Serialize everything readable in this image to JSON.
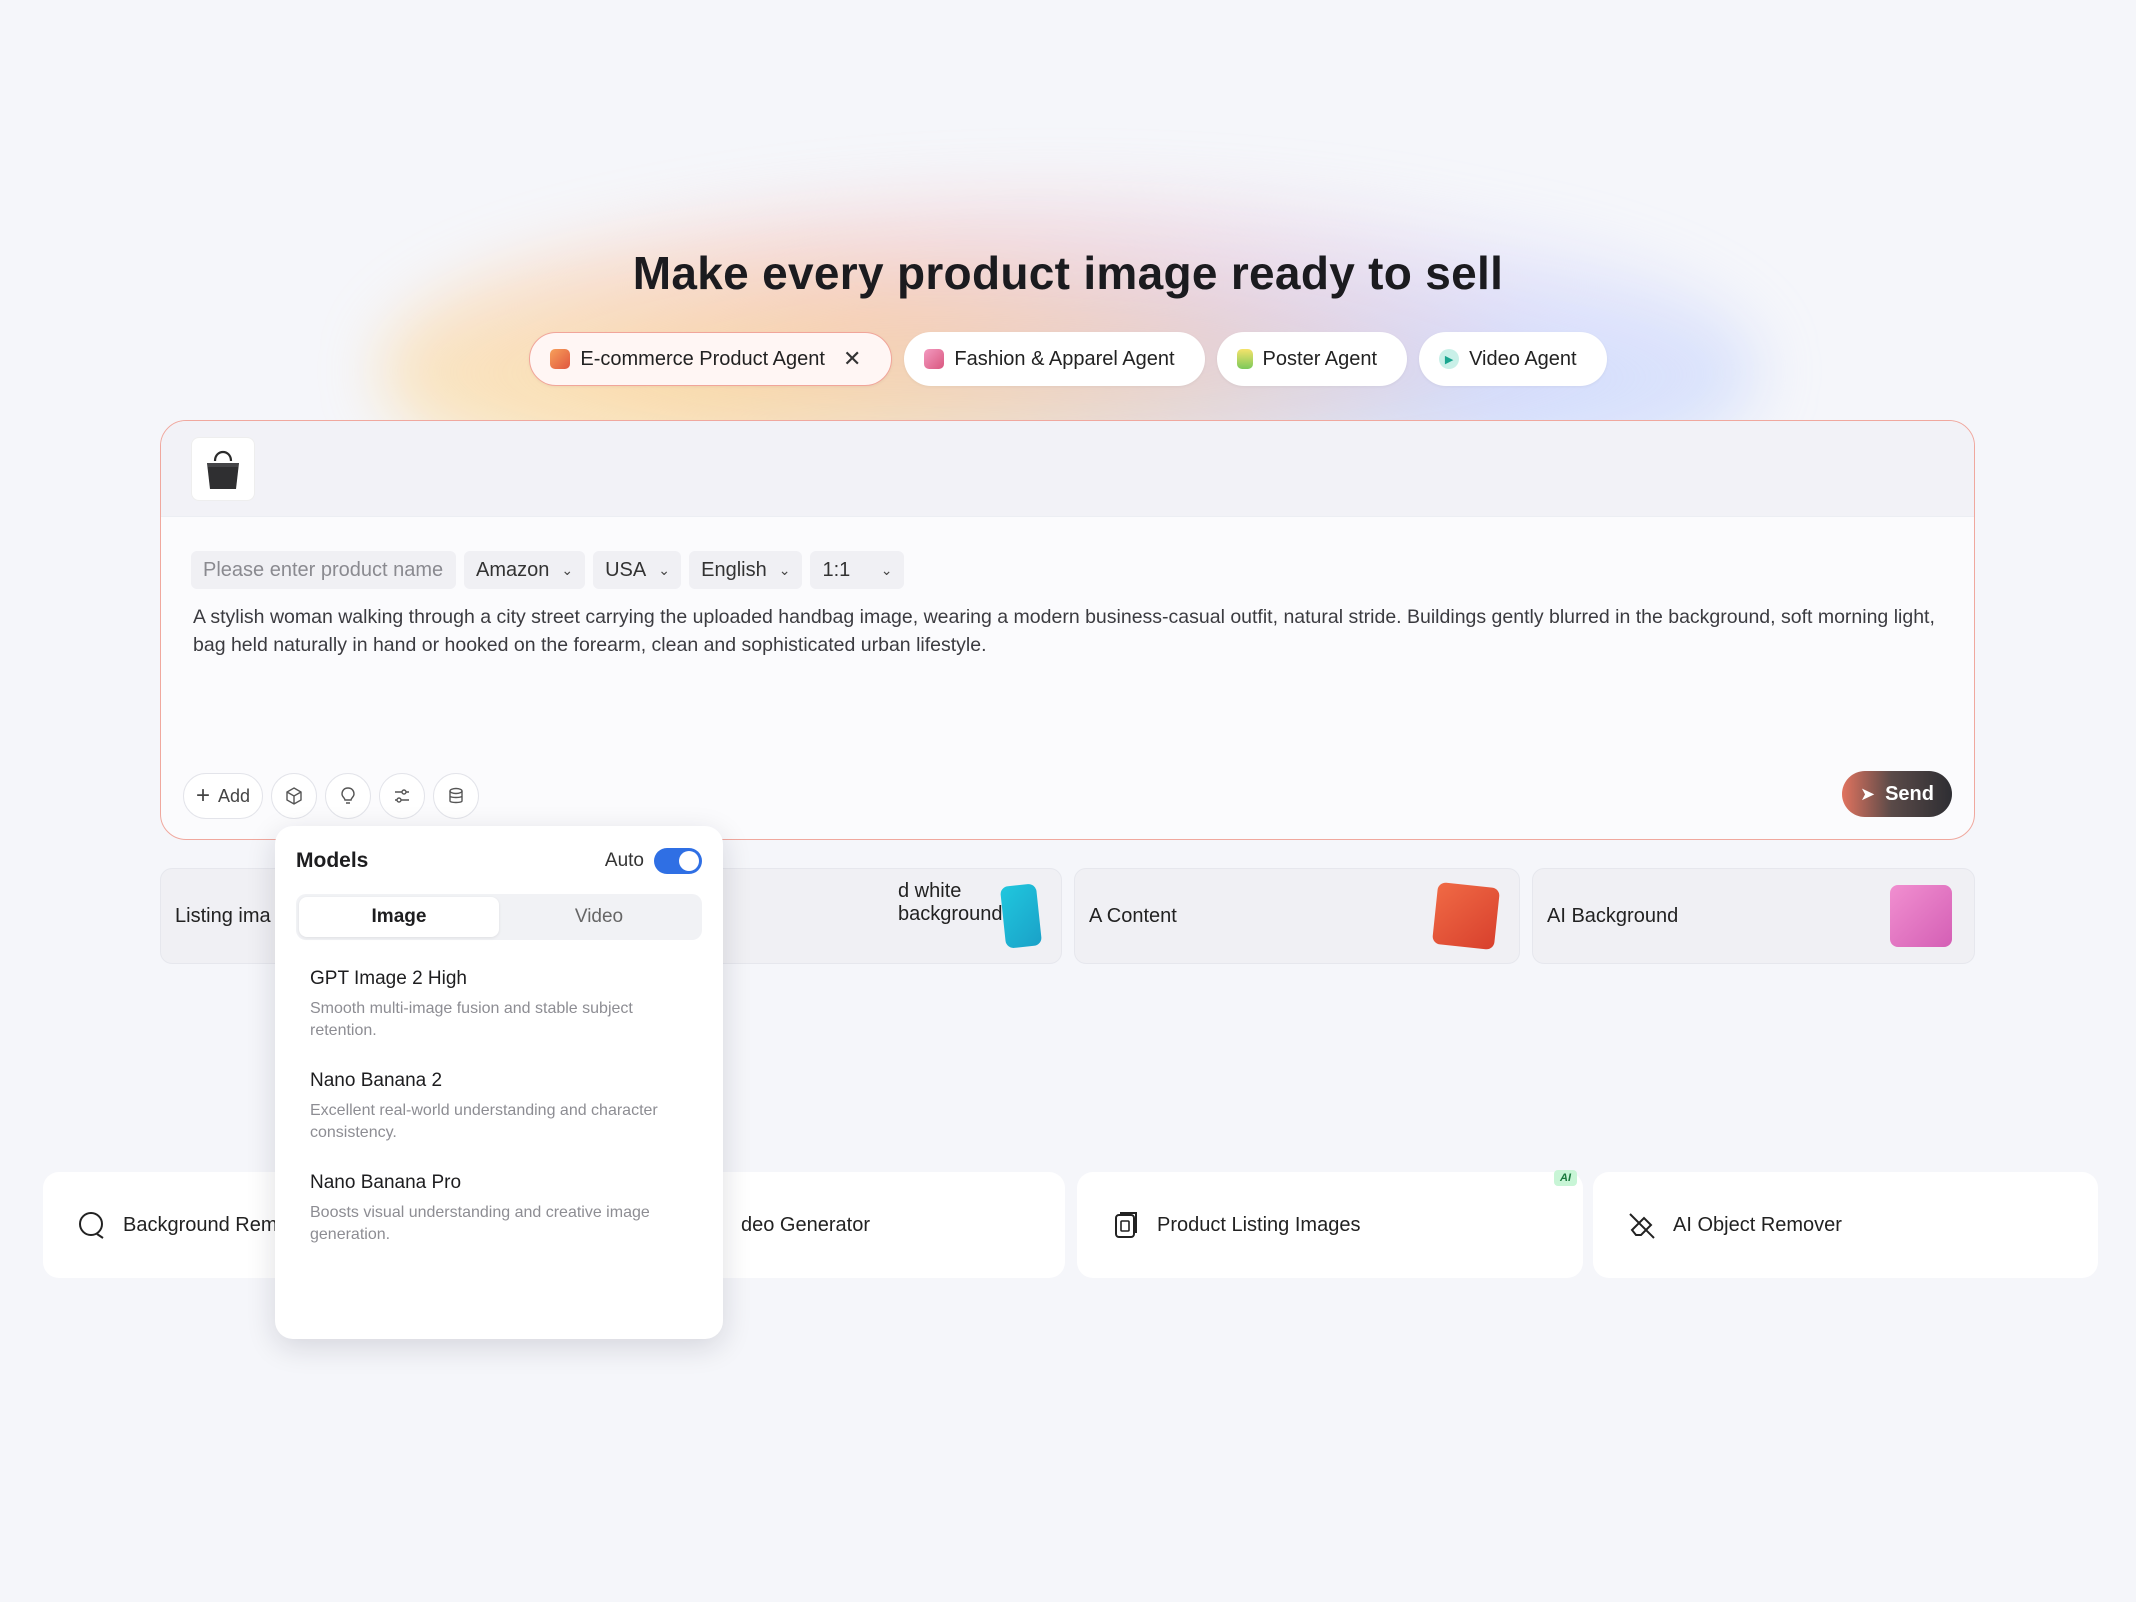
{
  "hero": {
    "title": "Make every product image ready to sell"
  },
  "agents": [
    {
      "label": "E-commerce Product Agent",
      "icon": "sofa-icon",
      "color": "#e86a4d",
      "active": true
    },
    {
      "label": "Fashion & Apparel Agent",
      "icon": "shirt-icon",
      "color": "#e96f9a"
    },
    {
      "label": "Poster Agent",
      "icon": "poster-icon",
      "color": "#8bcf5a"
    },
    {
      "label": "Video Agent",
      "icon": "play-icon",
      "color": "#2bb7a5"
    }
  ],
  "composer": {
    "product_placeholder": "Please enter product name",
    "platform": "Amazon",
    "region": "USA",
    "language": "English",
    "ratio": "1:1",
    "prompt": "A stylish woman walking through a city street carrying the uploaded handbag image, wearing a modern business-casual outfit, natural stride. Buildings gently blurred in the background, soft morning light, bag held naturally in hand or hooked on the forearm, clean and sophisticated urban lifestyle.",
    "add_label": "Add",
    "send_label": "Send"
  },
  "templates": [
    {
      "label": "Listing ima"
    },
    {
      "label": "d white background"
    },
    {
      "label": "A Content"
    },
    {
      "label": "AI Background"
    }
  ],
  "tools": [
    {
      "label": "Background Rem",
      "icon": "bg-remove-icon"
    },
    {
      "label": "deo Generator",
      "icon": "video-icon"
    },
    {
      "label": "Product Listing Images",
      "icon": "listing-icon",
      "badge": "AI"
    },
    {
      "label": "AI Object Remover",
      "icon": "eraser-icon"
    }
  ],
  "models_popup": {
    "title": "Models",
    "auto_label": "Auto",
    "auto_on": true,
    "tabs": [
      "Image",
      "Video"
    ],
    "active_tab": "Image",
    "models": [
      {
        "name": "GPT Image 2 High",
        "desc": "Smooth multi-image fusion and stable subject retention."
      },
      {
        "name": "Nano Banana 2",
        "desc": "Excellent real-world understanding and character consistency."
      },
      {
        "name": "Nano Banana Pro",
        "desc": "Boosts visual understanding and creative image generation."
      }
    ]
  }
}
